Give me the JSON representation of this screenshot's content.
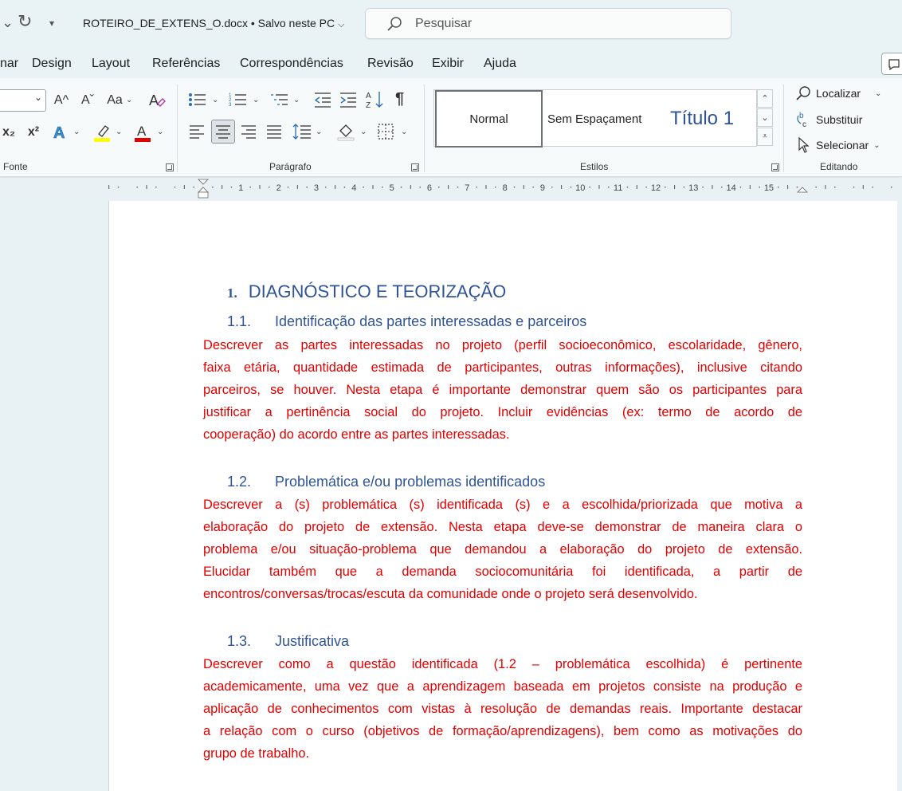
{
  "window": {
    "doc_title": "ROTEIRO_DE_EXTENS_O.docx • Salvo neste PC",
    "search_placeholder": "Pesquisar"
  },
  "menu": {
    "tabs": [
      "nar",
      "Design",
      "Layout",
      "Referências",
      "Correspondências",
      "Revisão",
      "Exibir",
      "Ajuda"
    ]
  },
  "ribbon": {
    "groups": {
      "font": "Fonte",
      "paragraph": "Parágrafo",
      "styles": "Estilos",
      "editing": "Editando"
    },
    "font_buttons": {
      "grow": "A^",
      "shrink": "Aˇ",
      "case": "Aa",
      "subscript": "x₂",
      "superscript": "x²"
    },
    "styles": [
      "Normal",
      "Sem Espaçament",
      "Título 1"
    ],
    "editing": {
      "find": "Localizar",
      "replace": "Substituir",
      "select": "Selecionar"
    },
    "highlight_color": "#ffff00",
    "font_color": "#e00000"
  },
  "ruler": {
    "numbers": [
      "1",
      "2",
      "3",
      "4",
      "5",
      "6",
      "7",
      "8",
      "9",
      "10",
      "11",
      "12",
      "13",
      "14",
      "15"
    ]
  },
  "document": {
    "heading1": {
      "num": "1.",
      "text": "DIAGNÓSTICO E TEORIZAÇÃO"
    },
    "sections": [
      {
        "num": "1.1.",
        "title": "Identificação das partes interessadas e parceiros",
        "lines": [
          "Descrever as partes interessadas no projeto (perfil socioeconômico, escolaridade, gênero,",
          "faixa etária, quantidade estimada de participantes, outras informações), inclusive citando",
          "parceiros, se houver. Nesta etapa é importante demonstrar quem são os participantes para",
          "justificar a pertinência social do projeto. Incluir evidências (ex: termo de acordo de",
          "cooperação) do acordo entre as partes interessadas."
        ]
      },
      {
        "num": "1.2.",
        "title": "Problemática e/ou problemas identificados",
        "lines": [
          "Descrever a (s) problemática (s) identificada (s) e a escolhida/priorizada que motiva a",
          "elaboração do projeto de extensão. Nesta etapa deve-se demonstrar de maneira clara o",
          "problema e/ou situação-problema que demandou a elaboração do projeto de extensão.",
          "Elucidar também que a demanda sociocomunitária foi identificada, a partir de",
          "encontros/conversas/trocas/escuta da comunidade onde o projeto será desenvolvido."
        ]
      },
      {
        "num": "1.3.",
        "title": "Justificativa",
        "lines": [
          "Descrever como a questão identificada (1.2 – problemática escolhida) é pertinente",
          "academicamente, uma vez que a aprendizagem baseada em projetos consiste na produção e",
          "aplicação de conhecimentos com vistas à resolução de demandas reais. Importante destacar",
          "a relação com o curso (objetivos de formação/aprendizagens), bem como as motivações do",
          "grupo de trabalho."
        ]
      }
    ],
    "text_color": "#e00000",
    "heading_color": "#2f5496"
  }
}
